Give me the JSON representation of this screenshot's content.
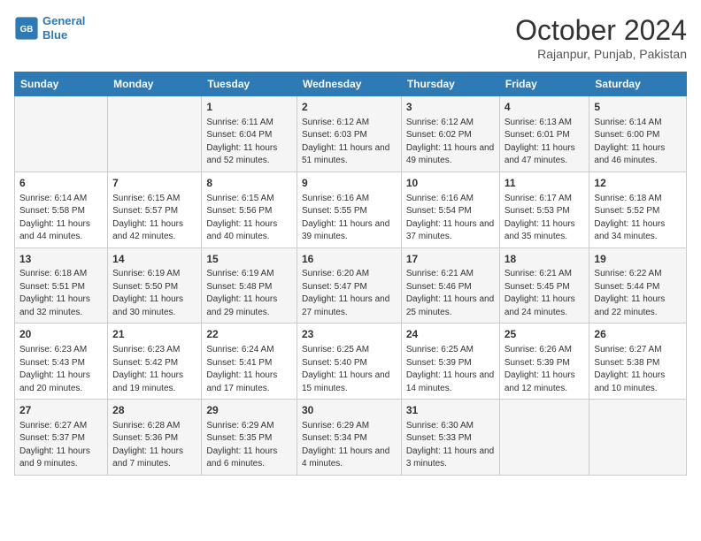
{
  "header": {
    "logo_line1": "General",
    "logo_line2": "Blue",
    "title": "October 2024",
    "subtitle": "Rajanpur, Punjab, Pakistan"
  },
  "days_of_week": [
    "Sunday",
    "Monday",
    "Tuesday",
    "Wednesday",
    "Thursday",
    "Friday",
    "Saturday"
  ],
  "weeks": [
    [
      {
        "day": "",
        "info": ""
      },
      {
        "day": "",
        "info": ""
      },
      {
        "day": "1",
        "info": "Sunrise: 6:11 AM\nSunset: 6:04 PM\nDaylight: 11 hours and 52 minutes."
      },
      {
        "day": "2",
        "info": "Sunrise: 6:12 AM\nSunset: 6:03 PM\nDaylight: 11 hours and 51 minutes."
      },
      {
        "day": "3",
        "info": "Sunrise: 6:12 AM\nSunset: 6:02 PM\nDaylight: 11 hours and 49 minutes."
      },
      {
        "day": "4",
        "info": "Sunrise: 6:13 AM\nSunset: 6:01 PM\nDaylight: 11 hours and 47 minutes."
      },
      {
        "day": "5",
        "info": "Sunrise: 6:14 AM\nSunset: 6:00 PM\nDaylight: 11 hours and 46 minutes."
      }
    ],
    [
      {
        "day": "6",
        "info": "Sunrise: 6:14 AM\nSunset: 5:58 PM\nDaylight: 11 hours and 44 minutes."
      },
      {
        "day": "7",
        "info": "Sunrise: 6:15 AM\nSunset: 5:57 PM\nDaylight: 11 hours and 42 minutes."
      },
      {
        "day": "8",
        "info": "Sunrise: 6:15 AM\nSunset: 5:56 PM\nDaylight: 11 hours and 40 minutes."
      },
      {
        "day": "9",
        "info": "Sunrise: 6:16 AM\nSunset: 5:55 PM\nDaylight: 11 hours and 39 minutes."
      },
      {
        "day": "10",
        "info": "Sunrise: 6:16 AM\nSunset: 5:54 PM\nDaylight: 11 hours and 37 minutes."
      },
      {
        "day": "11",
        "info": "Sunrise: 6:17 AM\nSunset: 5:53 PM\nDaylight: 11 hours and 35 minutes."
      },
      {
        "day": "12",
        "info": "Sunrise: 6:18 AM\nSunset: 5:52 PM\nDaylight: 11 hours and 34 minutes."
      }
    ],
    [
      {
        "day": "13",
        "info": "Sunrise: 6:18 AM\nSunset: 5:51 PM\nDaylight: 11 hours and 32 minutes."
      },
      {
        "day": "14",
        "info": "Sunrise: 6:19 AM\nSunset: 5:50 PM\nDaylight: 11 hours and 30 minutes."
      },
      {
        "day": "15",
        "info": "Sunrise: 6:19 AM\nSunset: 5:48 PM\nDaylight: 11 hours and 29 minutes."
      },
      {
        "day": "16",
        "info": "Sunrise: 6:20 AM\nSunset: 5:47 PM\nDaylight: 11 hours and 27 minutes."
      },
      {
        "day": "17",
        "info": "Sunrise: 6:21 AM\nSunset: 5:46 PM\nDaylight: 11 hours and 25 minutes."
      },
      {
        "day": "18",
        "info": "Sunrise: 6:21 AM\nSunset: 5:45 PM\nDaylight: 11 hours and 24 minutes."
      },
      {
        "day": "19",
        "info": "Sunrise: 6:22 AM\nSunset: 5:44 PM\nDaylight: 11 hours and 22 minutes."
      }
    ],
    [
      {
        "day": "20",
        "info": "Sunrise: 6:23 AM\nSunset: 5:43 PM\nDaylight: 11 hours and 20 minutes."
      },
      {
        "day": "21",
        "info": "Sunrise: 6:23 AM\nSunset: 5:42 PM\nDaylight: 11 hours and 19 minutes."
      },
      {
        "day": "22",
        "info": "Sunrise: 6:24 AM\nSunset: 5:41 PM\nDaylight: 11 hours and 17 minutes."
      },
      {
        "day": "23",
        "info": "Sunrise: 6:25 AM\nSunset: 5:40 PM\nDaylight: 11 hours and 15 minutes."
      },
      {
        "day": "24",
        "info": "Sunrise: 6:25 AM\nSunset: 5:39 PM\nDaylight: 11 hours and 14 minutes."
      },
      {
        "day": "25",
        "info": "Sunrise: 6:26 AM\nSunset: 5:39 PM\nDaylight: 11 hours and 12 minutes."
      },
      {
        "day": "26",
        "info": "Sunrise: 6:27 AM\nSunset: 5:38 PM\nDaylight: 11 hours and 10 minutes."
      }
    ],
    [
      {
        "day": "27",
        "info": "Sunrise: 6:27 AM\nSunset: 5:37 PM\nDaylight: 11 hours and 9 minutes."
      },
      {
        "day": "28",
        "info": "Sunrise: 6:28 AM\nSunset: 5:36 PM\nDaylight: 11 hours and 7 minutes."
      },
      {
        "day": "29",
        "info": "Sunrise: 6:29 AM\nSunset: 5:35 PM\nDaylight: 11 hours and 6 minutes."
      },
      {
        "day": "30",
        "info": "Sunrise: 6:29 AM\nSunset: 5:34 PM\nDaylight: 11 hours and 4 minutes."
      },
      {
        "day": "31",
        "info": "Sunrise: 6:30 AM\nSunset: 5:33 PM\nDaylight: 11 hours and 3 minutes."
      },
      {
        "day": "",
        "info": ""
      },
      {
        "day": "",
        "info": ""
      }
    ]
  ]
}
